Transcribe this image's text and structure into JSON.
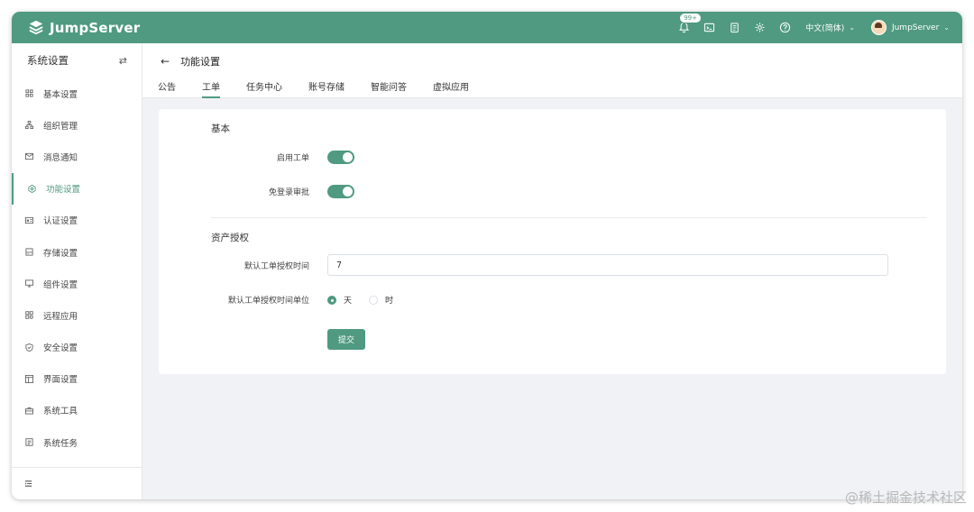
{
  "header": {
    "brand": "JumpServer",
    "notification_badge": "99+",
    "language": "中文(简体)",
    "username": "JumpServer"
  },
  "sidebar": {
    "title": "系统设置",
    "items": [
      {
        "label": "基本设置",
        "icon": "grid-icon"
      },
      {
        "label": "组织管理",
        "icon": "org-icon"
      },
      {
        "label": "消息通知",
        "icon": "message-icon"
      },
      {
        "label": "功能设置",
        "icon": "feature-icon",
        "active": true
      },
      {
        "label": "认证设置",
        "icon": "auth-icon"
      },
      {
        "label": "存储设置",
        "icon": "storage-icon"
      },
      {
        "label": "组件设置",
        "icon": "component-icon"
      },
      {
        "label": "远程应用",
        "icon": "apps-icon"
      },
      {
        "label": "安全设置",
        "icon": "shield-icon"
      },
      {
        "label": "界面设置",
        "icon": "interface-icon"
      },
      {
        "label": "系统工具",
        "icon": "toolbox-icon"
      },
      {
        "label": "系统任务",
        "icon": "task-icon"
      }
    ]
  },
  "page": {
    "title": "功能设置",
    "tabs": [
      {
        "label": "公告"
      },
      {
        "label": "工单",
        "active": true
      },
      {
        "label": "任务中心"
      },
      {
        "label": "账号存储"
      },
      {
        "label": "智能问答"
      },
      {
        "label": "虚拟应用"
      }
    ]
  },
  "form": {
    "section_basic": "基本",
    "enable_ticket_label": "启用工单",
    "enable_ticket_on": true,
    "login_review_label": "免登录审批",
    "login_review_on": true,
    "section_asset": "资产授权",
    "duration_label": "默认工单授权时间",
    "duration_value": "7",
    "unit_label": "默认工单授权时间单位",
    "unit_options": [
      "天",
      "时"
    ],
    "unit_selected": "天",
    "submit_label": "提交"
  },
  "watermark": "@稀土掘金技术社区",
  "colors": {
    "accent": "#4f9a80"
  }
}
